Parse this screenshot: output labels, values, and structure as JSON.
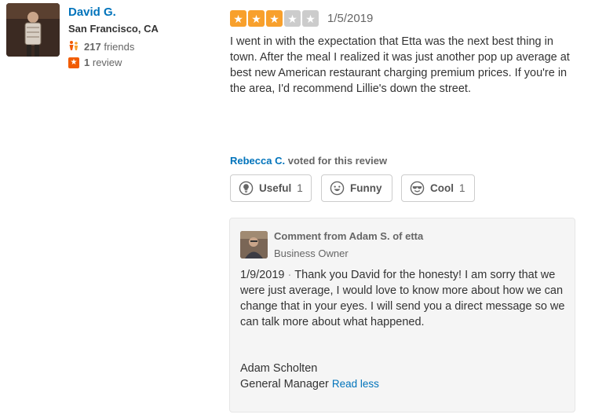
{
  "reviewer": {
    "name": "David G.",
    "location": "San Francisco, CA",
    "friends_count": "217",
    "friends_label": "friends",
    "reviews_count": "1",
    "reviews_label": "review"
  },
  "review": {
    "rating": 3,
    "max_rating": 5,
    "date": "1/5/2019",
    "text": "I went in with the expectation that Etta was the next best thing in town. After the meal I realized it was just another pop up average at best new American restaurant charging premium prices. If you're in the area, I'd recommend Lillie's down the street."
  },
  "votes": {
    "voter_name": "Rebecca C.",
    "voted_text": "voted for this review",
    "useful_label": "Useful",
    "useful_count": "1",
    "funny_label": "Funny",
    "funny_count": "",
    "cool_label": "Cool",
    "cool_count": "1"
  },
  "owner_comment": {
    "header": "Comment from Adam S. of etta",
    "role": "Business Owner",
    "date": "1/9/2019",
    "separator": "·",
    "text": "Thank you David for the honesty! I am sorry that we were just average, I would love to know more about how we can change that in your eyes. I will send you a direct message so we can talk more about what happened.",
    "signature_name": "Adam Scholten",
    "signature_title": "General Manager",
    "read_less": "Read less"
  },
  "colors": {
    "link": "#0073bb",
    "star_on": "#f8a02c",
    "star_off": "#cccccc",
    "review_badge": "#f15c00"
  },
  "icons": {
    "friends": "friends-icon",
    "review": "star-badge-icon",
    "useful": "lightbulb-icon",
    "funny": "smiley-icon",
    "cool": "sunglasses-icon"
  }
}
